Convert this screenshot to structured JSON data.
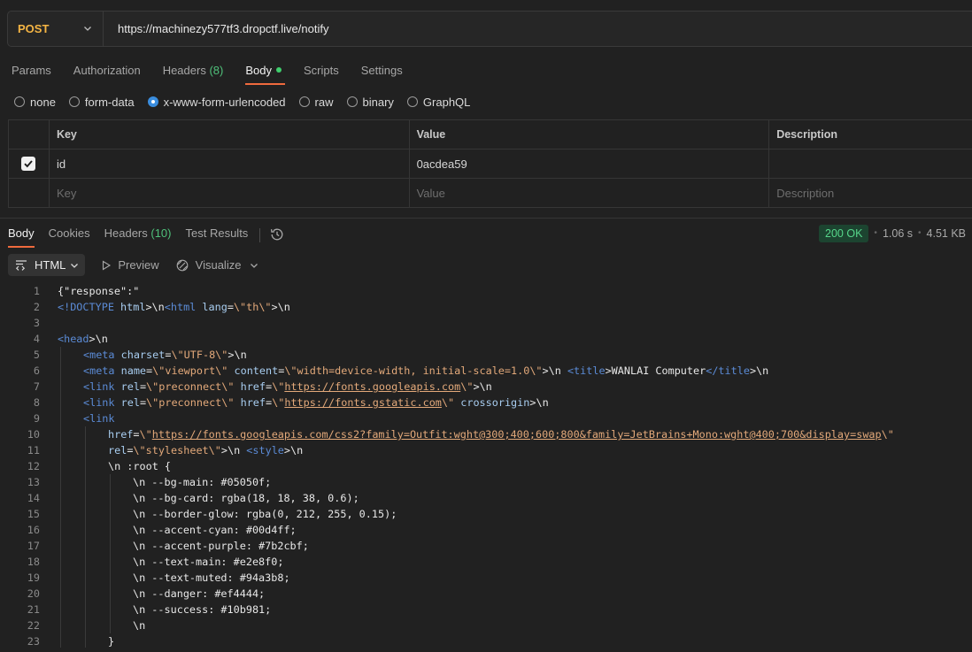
{
  "request": {
    "method": "POST",
    "url": "https://machinezy577tf3.dropctf.live/notify"
  },
  "request_tabs": {
    "params": "Params",
    "authorization": "Authorization",
    "headers": "Headers",
    "headers_count": "(8)",
    "body": "Body",
    "scripts": "Scripts",
    "settings": "Settings"
  },
  "body_types": {
    "none": "none",
    "form_data": "form-data",
    "urlencoded": "x-www-form-urlencoded",
    "raw": "raw",
    "binary": "binary",
    "graphql": "GraphQL"
  },
  "kv_table": {
    "headers": {
      "key": "Key",
      "value": "Value",
      "description": "Description"
    },
    "rows": [
      {
        "checked": true,
        "key": "id",
        "value": "0acdea59",
        "description": ""
      }
    ],
    "placeholder": {
      "key": "Key",
      "value": "Value",
      "description": "Description"
    }
  },
  "response_tabs": {
    "body": "Body",
    "cookies": "Cookies",
    "headers": "Headers",
    "headers_count": "(10)",
    "test_results": "Test Results"
  },
  "response_status": {
    "code": "200 OK",
    "time": "1.06 s",
    "size": "4.51 KB"
  },
  "view_controls": {
    "format": "HTML",
    "preview": "Preview",
    "visualize": "Visualize"
  },
  "code": {
    "line_numbers": [
      "1",
      "2",
      "3",
      "4",
      "5",
      "6",
      "7",
      "8",
      "9",
      "10",
      "11",
      "12",
      "13",
      "14",
      "15",
      "16",
      "17",
      "18",
      "19",
      "20",
      "21",
      "22",
      "23"
    ],
    "l1": "{\"response\":\"",
    "l2_tag": "<!DOCTYPE",
    "l2_html": "html",
    "l2_rest1": ">\\n",
    "l2_tag2": "<html",
    "l2_attr": "lang",
    "l2_eq": "=",
    "l2_val": "\\\"th\\\"",
    "l2_end": ">\\n",
    "l4_tag": "<head",
    "l4_end": ">\\n",
    "l5_tag": "<meta",
    "l5_attr": "charset",
    "l5_val": "\\\"UTF-8\\\"",
    "l5_end": ">\\n",
    "l6_tag": "<meta",
    "l6_attr1": "name",
    "l6_val1": "\\\"viewport\\\"",
    "l6_attr2": "content",
    "l6_val2": "\\\"width=device-width, initial-scale=1.0\\\"",
    "l6_mid": ">\\n ",
    "l6_ttag": "<title",
    "l6_title": ">WANLAI Computer",
    "l6_tend": "</title",
    "l6_end": ">\\n",
    "l7_tag": "<link",
    "l7_attr1": "rel",
    "l7_val1": "\\\"preconnect\\\"",
    "l7_attr2": "href",
    "l7_q1": "\\\"",
    "l7_url": "https://fonts.googleapis.com",
    "l7_q2": "\\\"",
    "l7_end": ">\\n",
    "l8_tag": "<link",
    "l8_attr1": "rel",
    "l8_val1": "\\\"preconnect\\\"",
    "l8_attr2": "href",
    "l8_q1": "\\\"",
    "l8_url": "https://fonts.gstatic.com",
    "l8_q2": "\\\"",
    "l8_attr3": "crossorigin",
    "l8_end": ">\\n",
    "l9_tag": "<link",
    "l10_attr": "href",
    "l10_q1": "\\\"",
    "l10_url": "https://fonts.googleapis.com/css2?family=Outfit:wght@300;400;600;800&family=JetBrains+Mono:wght@400;700&display=swap",
    "l10_q2": "\\\"",
    "l11_attr": "rel",
    "l11_val": "\\\"stylesheet\\\"",
    "l11_mid": ">\\n ",
    "l11_tag": "<style",
    "l11_end": ">\\n",
    "l12": "\\n :root {",
    "l13": "\\n --bg-main: #05050f;",
    "l14": "\\n --bg-card: rgba(18, 18, 38, 0.6);",
    "l15": "\\n --border-glow: rgba(0, 212, 255, 0.15);",
    "l16": "\\n --accent-cyan: #00d4ff;",
    "l17": "\\n --accent-purple: #7b2cbf;",
    "l18": "\\n --text-main: #e2e8f0;",
    "l19": "\\n --text-muted: #94a3b8;",
    "l20": "\\n --danger: #ef4444;",
    "l21": "\\n --success: #10b981;",
    "l22": "\\n",
    "l23": "}"
  }
}
